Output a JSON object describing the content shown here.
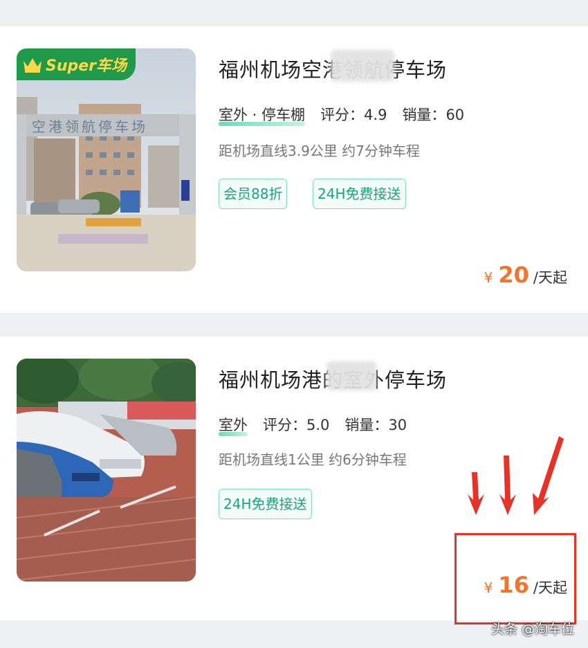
{
  "listings": [
    {
      "badge": "Super车场",
      "title": "福州机场空港领航停车场",
      "type": "室外 · 停车棚",
      "rating_label": "评分：",
      "rating": "4.9",
      "sales_label": "销量：",
      "sales": "60",
      "distance": "距机场直线3.9公里 约7分钟车程",
      "tags": [
        "会员88折",
        "24H免费接送"
      ],
      "price_symbol": "¥",
      "price": "20",
      "price_unit": "/天起",
      "photo_sign": "空港领航停车场"
    },
    {
      "title": "福州机场港的室外停车场",
      "type": "室外",
      "rating_label": "评分：",
      "rating": "5.0",
      "sales_label": "销量：",
      "sales": "30",
      "distance": "距机场直线1公里 约6分钟车程",
      "tags": [
        "24H免费接送"
      ],
      "price_symbol": "¥",
      "price": "16",
      "price_unit": "/天起"
    }
  ],
  "watermark": "头条 @淘车位",
  "colors": {
    "accent_price": "#f5732a",
    "tag_green": "#16a57c",
    "badge_green": "#1f9a4b",
    "highlight_red": "#e5332a"
  }
}
